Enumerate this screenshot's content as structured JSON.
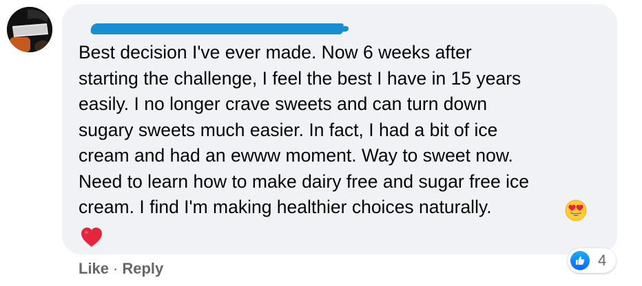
{
  "comment": {
    "text_lines": [
      "Best decision I've ever made. Now 6 weeks after",
      "starting the challenge, I feel the best I have in 15 years",
      "easily. I no longer crave sweets and can turn down",
      "sugary sweets much easier. In fact, I had a bit of ice",
      "cream and had an ewww moment. Way to sweet now.",
      "Need to learn how to make dairy free and sugar free ice",
      "cream. I find I'm making healthier choices naturally."
    ],
    "emojis": [
      "heart-eyes-emoji",
      "red-heart-emoji"
    ]
  },
  "reactions": {
    "icon": "like-icon",
    "count": "4"
  },
  "actions": {
    "like_label": "Like",
    "separator": "·",
    "reply_label": "Reply"
  },
  "colors": {
    "bubble_bg": "#f0f2f5",
    "text": "#050505",
    "secondary_text": "#65676b",
    "redaction": "#1a8fd0",
    "like_blue": "#0866ff"
  }
}
